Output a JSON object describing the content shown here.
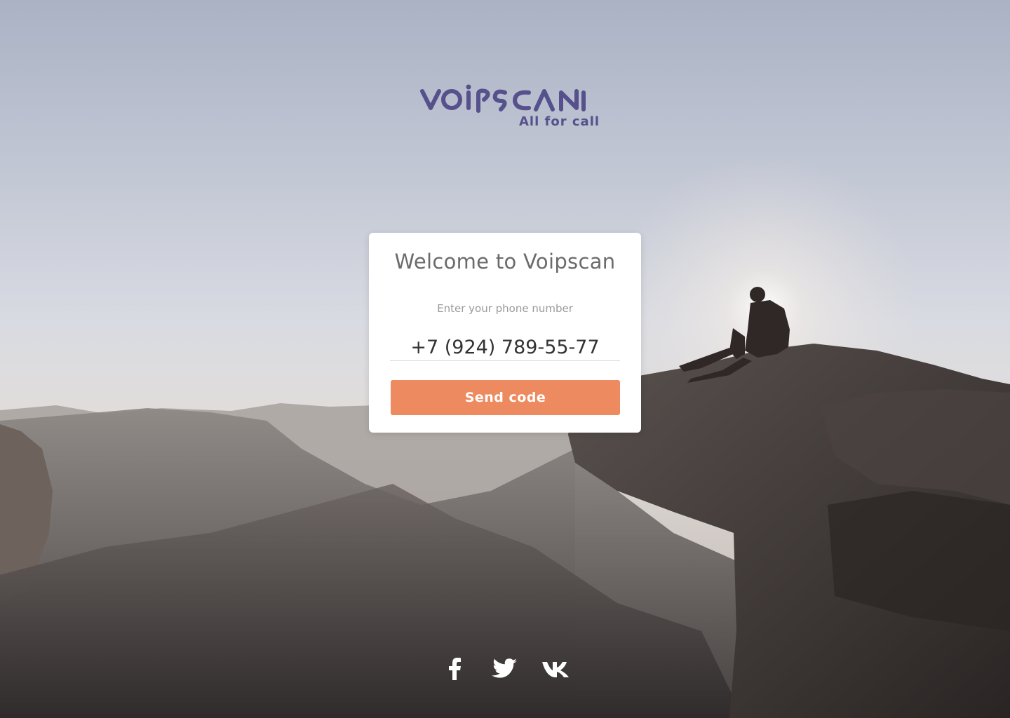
{
  "brand": {
    "name": "voipscan",
    "tagline": "All for call",
    "color": "#56508c"
  },
  "login_card": {
    "title": "Welcome to Voipscan",
    "phone_label": "Enter your phone number",
    "phone_value": "+7 (924) 789-55-77",
    "send_button_label": "Send code",
    "button_color": "#ee8a5f"
  },
  "social_links": [
    {
      "icon": "facebook-icon"
    },
    {
      "icon": "twitter-icon"
    },
    {
      "icon": "vk-icon"
    }
  ]
}
